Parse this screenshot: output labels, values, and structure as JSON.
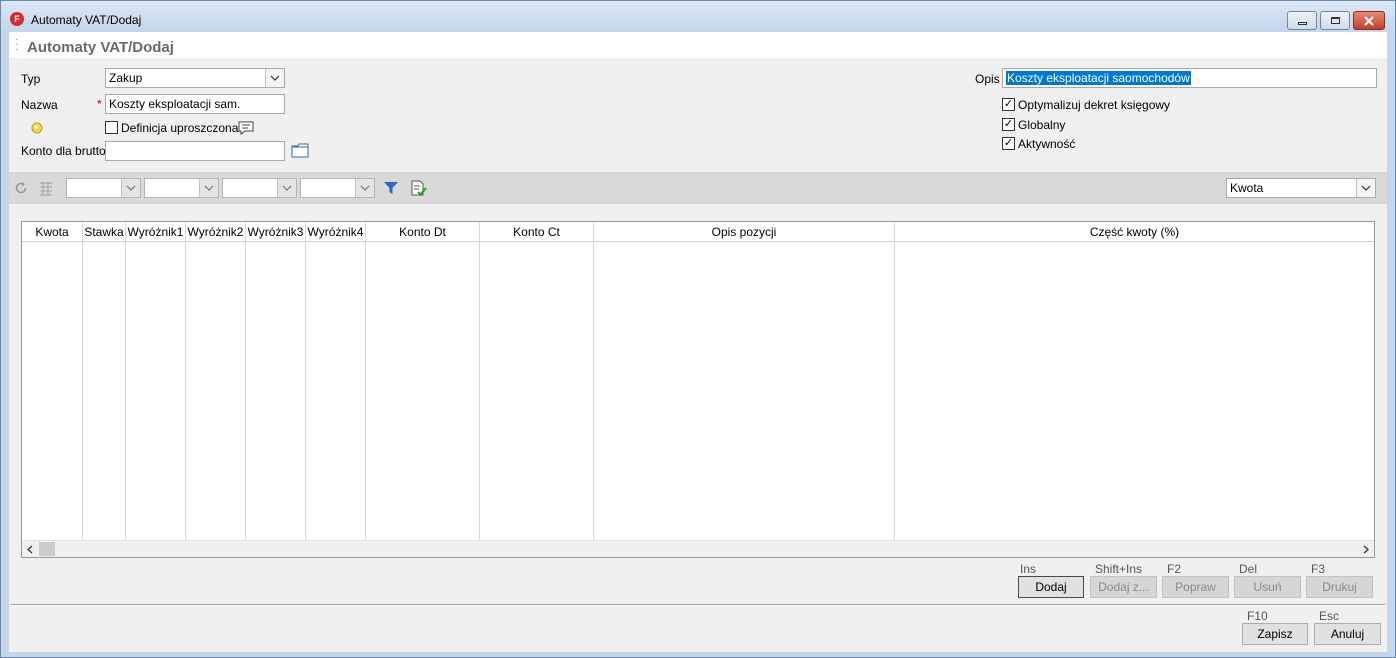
{
  "window": {
    "title": "Automaty VAT/Dodaj",
    "app_icon_letter": "F"
  },
  "page": {
    "title": "Automaty VAT/Dodaj"
  },
  "form": {
    "typ_label": "Typ",
    "typ_value": "Zakup",
    "nazwa_label": "Nazwa",
    "nazwa_required_mark": "*",
    "nazwa_value": "Koszty eksploatacji sam.",
    "definicja_label": "Definicja uproszczona",
    "definicja_checked": false,
    "konto_label": "Konto dla brutto",
    "konto_value": "",
    "opis_label": "Opis",
    "opis_value": "Koszty eksploatacji saomochodów",
    "optymalizuj_label": "Optymalizuj dekret księgowy",
    "optymalizuj_check": "✓",
    "globalny_label": "Globalny",
    "globalny_check": "✓",
    "aktywnosc_label": "Aktywność",
    "aktywnosc_check": "✓"
  },
  "toolbar": {
    "sort_combo_value": "Kwota",
    "filter_combos": [
      "",
      "",
      "",
      ""
    ]
  },
  "grid": {
    "columns": [
      "Kwota",
      "Stawka",
      "Wyróżnik1",
      "Wyróżnik2",
      "Wyróżnik3",
      "Wyróżnik4",
      "Konto Dt",
      "Konto Ct",
      "Opis pozycji",
      "Część kwoty (%)"
    ],
    "rows": []
  },
  "row_actions": {
    "dodaj": {
      "label": "Dodaj",
      "shortcut": "Ins"
    },
    "dodaj_z": {
      "label": "Dodaj z...",
      "shortcut": "Shift+Ins"
    },
    "popraw": {
      "label": "Popraw",
      "shortcut": "F2"
    },
    "usun": {
      "label": "Usuń",
      "shortcut": "Del"
    },
    "drukuj": {
      "label": "Drukuj",
      "shortcut": "F3"
    }
  },
  "footer": {
    "zapisz": {
      "label": "Zapisz",
      "shortcut": "F10"
    },
    "anuluj": {
      "label": "Anuluj",
      "shortcut": "Esc"
    }
  },
  "colors": {
    "accent": "#0078d7",
    "filter_icon": "#1f6fc4",
    "required": "#d00000",
    "close_button": "#c2402c"
  }
}
